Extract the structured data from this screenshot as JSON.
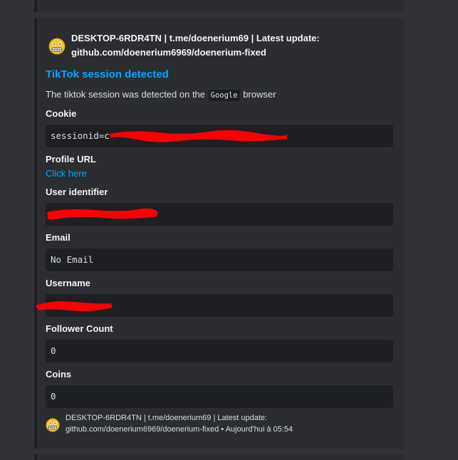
{
  "embed": {
    "author": {
      "name_line1": "DESKTOP-6RDR4TN | t.me/doenerium69 | Latest update:",
      "name_line2": "github.com/doenerium6969/doenerium-fixed",
      "avatar_icon": "grimacing-face-icon"
    },
    "title": "TikTok session detected",
    "description": {
      "before": "The tiktok session was detected on the",
      "code": "Google",
      "after": "browser"
    },
    "fields": {
      "cookie": {
        "name": "Cookie",
        "value": "sessionid=c"
      },
      "profile_url": {
        "name": "Profile URL",
        "value": "Click here"
      },
      "user_identifier": {
        "name": "User identifier",
        "value": ""
      },
      "email": {
        "name": "Email",
        "value": "No Email"
      },
      "username": {
        "name": "Username",
        "value": ""
      },
      "follower_count": {
        "name": "Follower Count",
        "value": "0"
      },
      "coins": {
        "name": "Coins",
        "value": "0"
      }
    },
    "footer": {
      "text_line1": "DESKTOP-6RDR4TN | t.me/doenerium69 | Latest update:",
      "text_line2": "github.com/doenerium6969/doenerium-fixed • Aujourd'hui à 05:54",
      "avatar_icon": "grimacing-face-icon"
    },
    "colors": {
      "link": "#00a8fc",
      "embed_bg": "#2b2d31",
      "code_bg": "#1e1f22",
      "redaction": "#ff0000"
    }
  }
}
